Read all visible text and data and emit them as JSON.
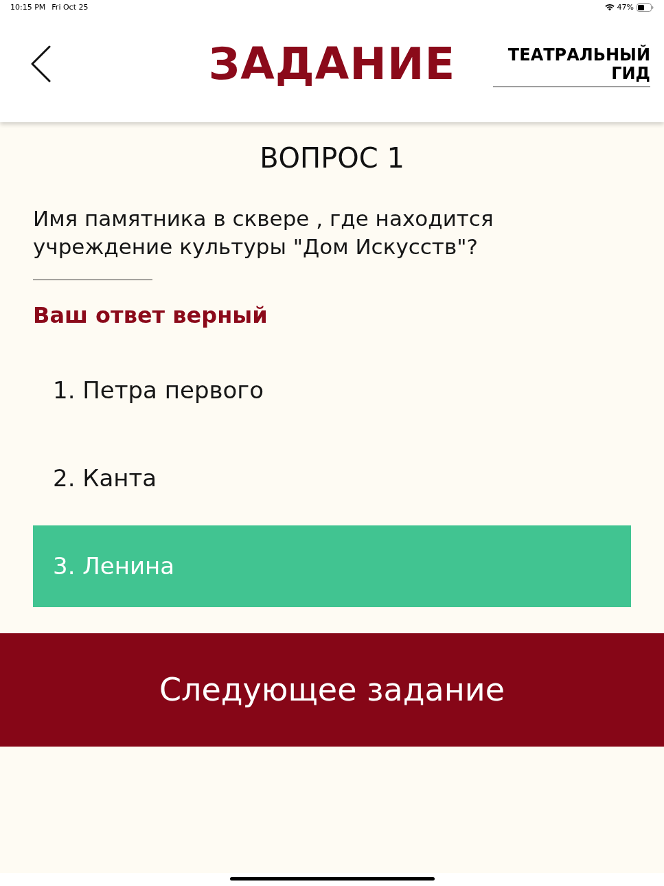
{
  "status_bar": {
    "time": "10:15 PM",
    "date": "Fri Oct 25",
    "battery": "47%"
  },
  "header": {
    "title": "ЗАДАНИЕ",
    "logo": [
      "ТЕАТРАЛЬНЫЙ",
      "ГИД"
    ]
  },
  "question": {
    "heading": "ВОПРОС 1",
    "text": "Имя памятника в сквере , где находится учреждение культуры \"Дом Искусств\"?",
    "result": "Ваш ответ верный"
  },
  "options": [
    {
      "label": "1. Петра первого",
      "selected": false
    },
    {
      "label": "2. Канта",
      "selected": false
    },
    {
      "label": "3. Ленина",
      "selected": true
    }
  ],
  "next_button": "Следующее задание"
}
